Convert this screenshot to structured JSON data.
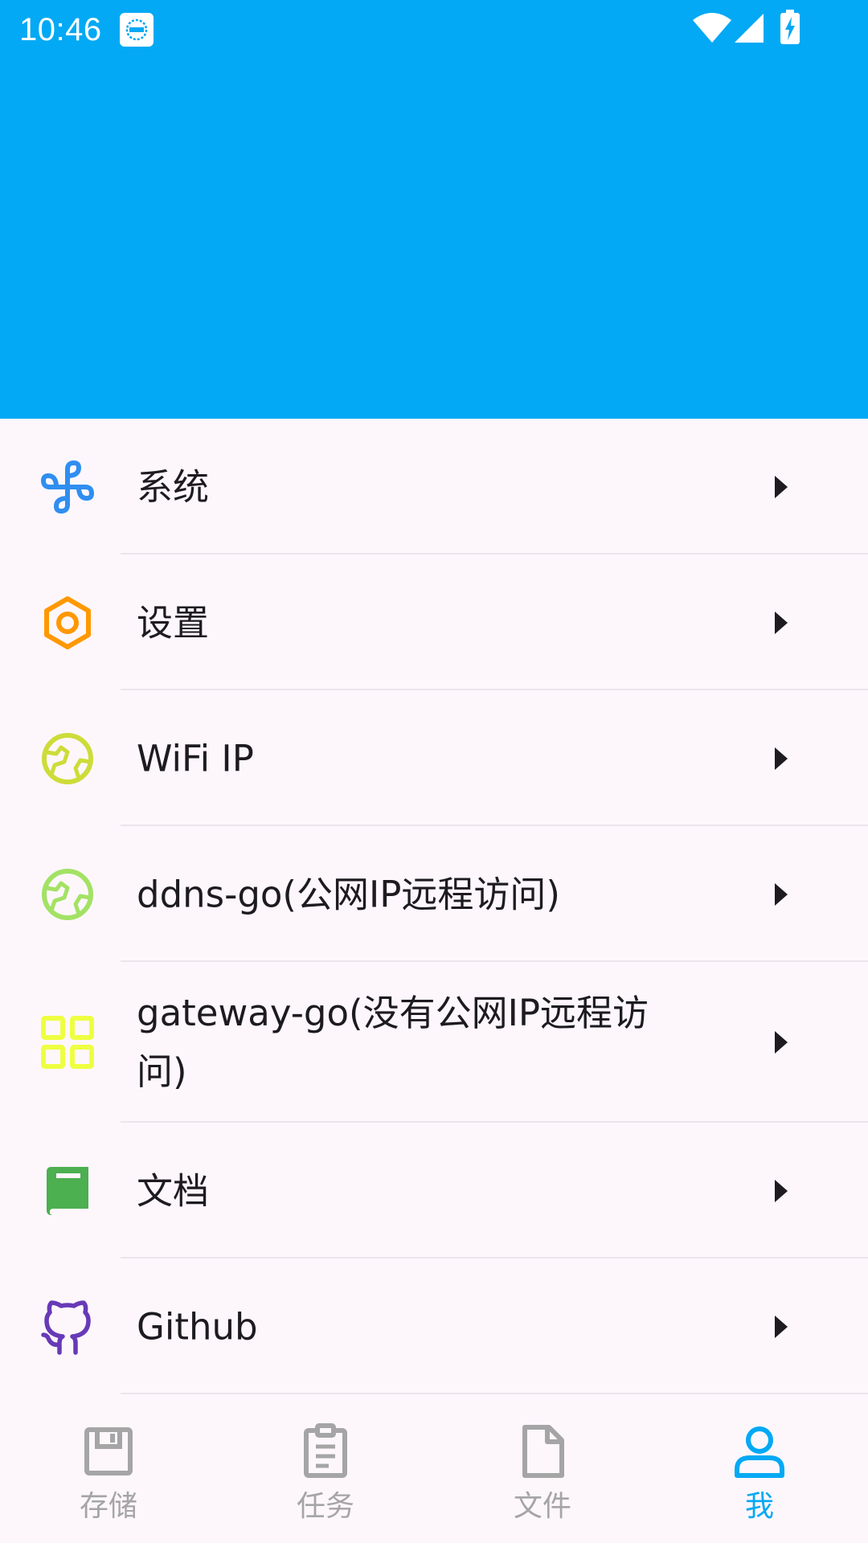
{
  "status_bar": {
    "time": "10:46"
  },
  "colors": {
    "header": "#03a9f4",
    "background": "#fdf7fc",
    "active": "#03a9f4",
    "inactive": "#a5a5a5"
  },
  "menu": {
    "items": [
      {
        "label": "系统",
        "icon": "system-plus-icon",
        "color": "#2f8ef0"
      },
      {
        "label": "设置",
        "icon": "settings-hex-icon",
        "color": "#ff9800"
      },
      {
        "label": "WiFi IP",
        "icon": "globe-icon",
        "color": "#cddc39"
      },
      {
        "label": "ddns-go(公网IP远程访问)",
        "icon": "globe-icon",
        "color": "#a3e264"
      },
      {
        "label": "gateway-go(没有公网IP远程访问)",
        "icon": "grid-icon",
        "color": "#eeff41"
      },
      {
        "label": "文档",
        "icon": "book-icon",
        "color": "#4caf50"
      },
      {
        "label": "Github",
        "icon": "github-icon",
        "color": "#673ab7"
      }
    ]
  },
  "bottom_nav": {
    "items": [
      {
        "label": "存储",
        "icon": "storage-icon",
        "active": false
      },
      {
        "label": "任务",
        "icon": "clipboard-icon",
        "active": false
      },
      {
        "label": "文件",
        "icon": "file-icon",
        "active": false
      },
      {
        "label": "我",
        "icon": "person-icon",
        "active": true
      }
    ]
  }
}
